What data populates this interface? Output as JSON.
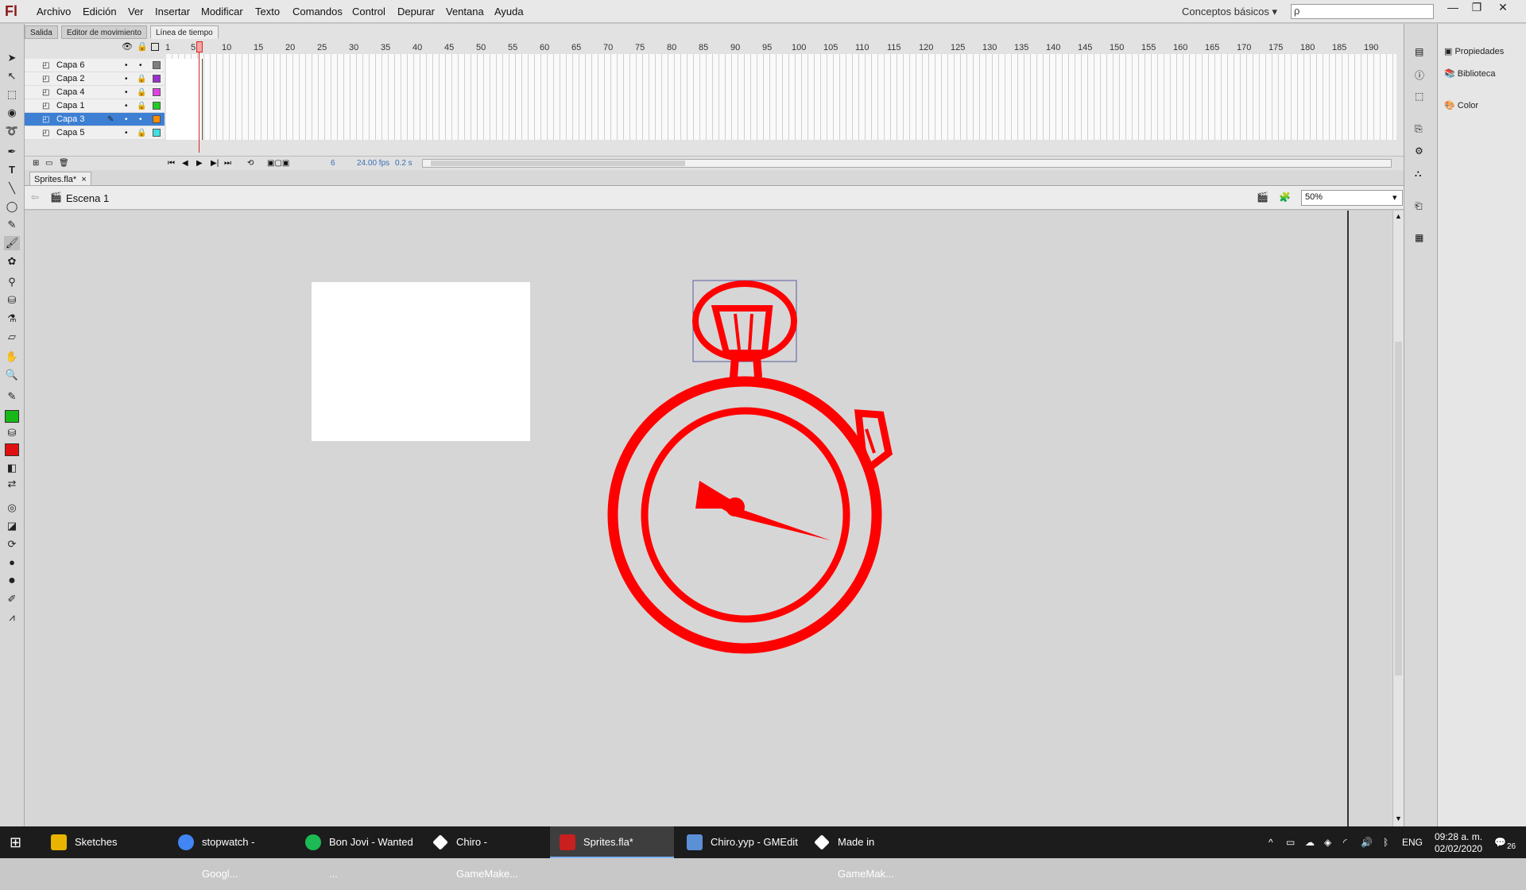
{
  "app": {
    "logo": "Fl"
  },
  "menu": [
    "Archivo",
    "Edición",
    "Ver",
    "Insertar",
    "Modificar",
    "Texto",
    "Comandos",
    "Control",
    "Depurar",
    "Ventana",
    "Ayuda"
  ],
  "workspace": {
    "label": "Conceptos básicos",
    "search_placeholder": "ρ"
  },
  "window_buttons": [
    "—",
    "❐",
    "✕"
  ],
  "panel_tabs": [
    "Salida",
    "Editor de movimiento",
    "Línea de tiempo"
  ],
  "layers": [
    {
      "name": "Capa 6",
      "color": "#808080"
    },
    {
      "name": "Capa 2",
      "color": "#9b30d0"
    },
    {
      "name": "Capa 4",
      "color": "#e040e0"
    },
    {
      "name": "Capa 1",
      "color": "#22cc22"
    },
    {
      "name": "Capa 3",
      "color": "#ff8c00",
      "selected": true
    },
    {
      "name": "Capa 5",
      "color": "#40e0e0"
    }
  ],
  "frame_ticks": [
    "1",
    "5",
    "10",
    "15",
    "20",
    "25",
    "30",
    "35",
    "40",
    "45",
    "50",
    "55",
    "60",
    "65",
    "70",
    "75",
    "80",
    "85",
    "90",
    "95",
    "100",
    "105",
    "110",
    "115",
    "120",
    "125",
    "130",
    "135",
    "140",
    "145",
    "150",
    "155",
    "160",
    "165",
    "170",
    "175",
    "180",
    "185",
    "190"
  ],
  "timeline_footer": {
    "frame": "6",
    "fps": "24.00 fps",
    "time": "0.2 s"
  },
  "document_tab": {
    "title": "Sprites.fla*",
    "close": "×"
  },
  "scene": {
    "name": "Escena 1",
    "zoom": "50%"
  },
  "right_panel": [
    "Propiedades",
    "Biblioteca",
    "Color"
  ],
  "taskbar": {
    "items": [
      {
        "label": "Sketches",
        "color": "#e8b400"
      },
      {
        "label": "stopwatch - Googl...",
        "color": "#4285f4"
      },
      {
        "label": "Bon Jovi - Wanted ...",
        "color": "#1db954"
      },
      {
        "label": "Chiro - GameMake...",
        "color": "#ffffff"
      },
      {
        "label": "Sprites.fla*",
        "color": "#c8201f",
        "active": true
      },
      {
        "label": "Chiro.yyp - GMEdit",
        "color": "#5b8fd6"
      },
      {
        "label": "Made in GameMak...",
        "color": "#ffffff"
      }
    ],
    "lang": "ENG",
    "time": "09:28 a. m.",
    "date": "02/02/2020",
    "notifications": "26"
  },
  "colors": {
    "stroke": "#18b818",
    "fill": "#e01010",
    "drawing": "#ff0000"
  }
}
